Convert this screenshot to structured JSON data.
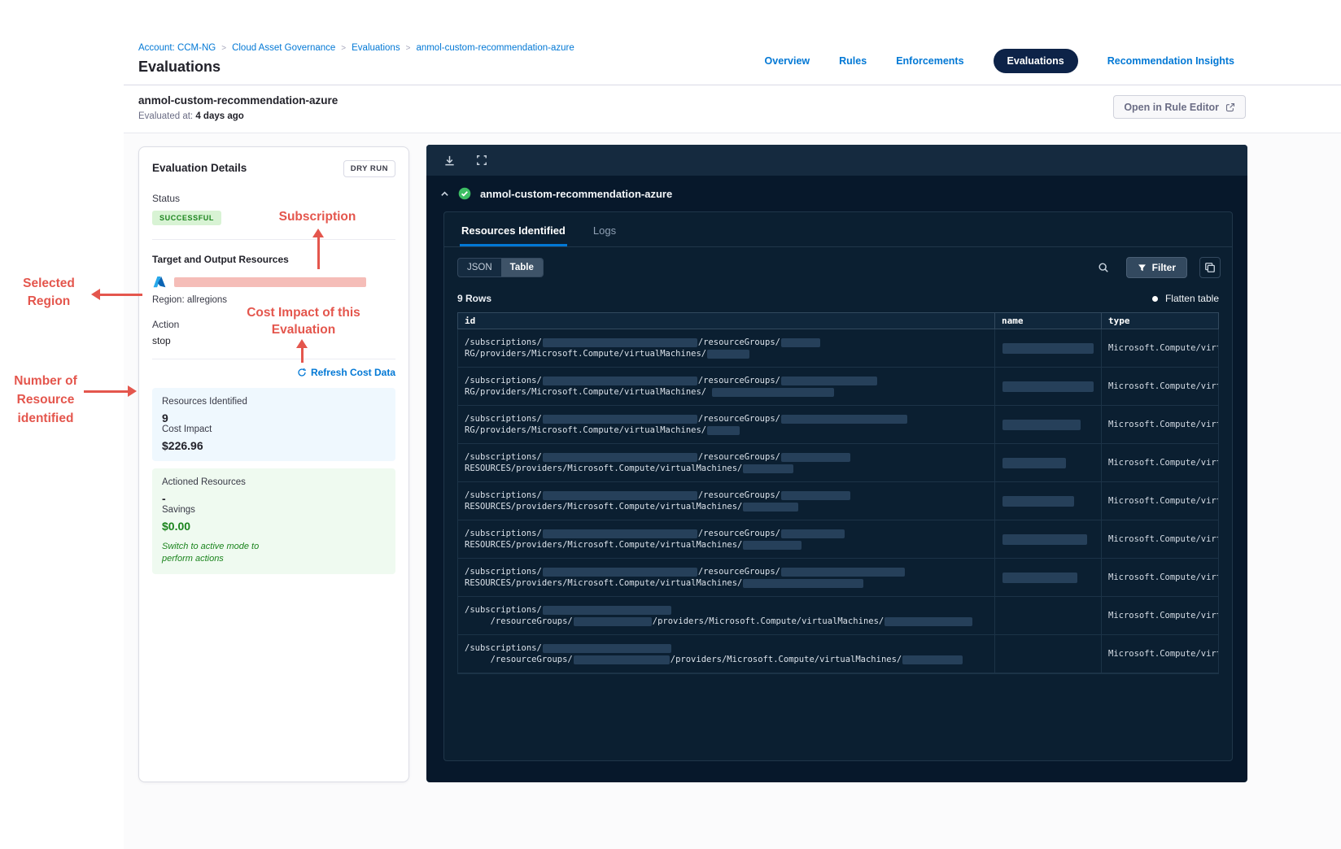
{
  "breadcrumb": {
    "items": [
      "Account: CCM-NG",
      "Cloud Asset Governance",
      "Evaluations",
      "anmol-custom-recommendation-azure"
    ],
    "separator": ">"
  },
  "page": {
    "title": "Evaluations"
  },
  "nav": {
    "tabs": [
      {
        "label": "Overview"
      },
      {
        "label": "Rules"
      },
      {
        "label": "Enforcements"
      },
      {
        "label": "Evaluations"
      },
      {
        "label": "Recommendation Insights"
      }
    ]
  },
  "subheader": {
    "rule_name": "anmol-custom-recommendation-azure",
    "evaluated_label": "Evaluated at:",
    "evaluated_value": "4 days ago",
    "open_rule_editor": "Open in Rule Editor"
  },
  "details": {
    "title": "Evaluation Details",
    "dry_run": "DRY RUN",
    "status_label": "Status",
    "status_value": "SUCCESSFUL",
    "target_label": "Target and Output Resources",
    "region": "Region: allregions",
    "action_label": "Action",
    "action_value": "stop",
    "refresh_link": "Refresh Cost Data",
    "resources_identified_label": "Resources Identified",
    "resources_identified_value": "9",
    "cost_impact_label": "Cost Impact",
    "cost_impact_value": "$226.96",
    "actioned_label": "Actioned Resources",
    "actioned_value": "-",
    "savings_label": "Savings",
    "savings_value": "$0.00",
    "active_mode_note": "Switch to active mode to perform actions"
  },
  "results_panel": {
    "title": "anmol-custom-recommendation-azure",
    "tabs": [
      {
        "label": "Resources Identified"
      },
      {
        "label": "Logs"
      }
    ],
    "view_toggle": [
      {
        "label": "JSON"
      },
      {
        "label": "Table"
      }
    ],
    "filter_label": "Filter",
    "rows_count": "9 Rows",
    "flatten_label": "Flatten table",
    "table": {
      "columns": [
        "id",
        "name",
        "type"
      ],
      "rows": [
        {
          "l1": [
            [
              "t",
              "/subscriptions/"
            ],
            [
              "r",
              190
            ],
            [
              "t",
              "/resourceGroups/"
            ],
            [
              "r",
              48
            ]
          ],
          "l2": [
            [
              "t",
              "RG/providers/Microsoft.Compute/virtualMachines/"
            ],
            [
              "r",
              52
            ]
          ],
          "name_w": 112,
          "type": "Microsoft.Compute/virtu"
        },
        {
          "l1": [
            [
              "t",
              "/subscriptions/"
            ],
            [
              "r",
              190
            ],
            [
              "t",
              "/resourceGroups/"
            ],
            [
              "r",
              118
            ]
          ],
          "l2": [
            [
              "t",
              "RG/providers/Microsoft.Compute/virtualMachines/ "
            ],
            [
              "r",
              150
            ]
          ],
          "name_w": 112,
          "type": "Microsoft.Compute/virtu"
        },
        {
          "l1": [
            [
              "t",
              "/subscriptions/"
            ],
            [
              "r",
              190
            ],
            [
              "t",
              "/resourceGroups/"
            ],
            [
              "r",
              155
            ]
          ],
          "l2": [
            [
              "t",
              "RG/providers/Microsoft.Compute/virtualMachines/"
            ],
            [
              "r",
              40
            ]
          ],
          "name_w": 96,
          "type": "Microsoft.Compute/virtu"
        },
        {
          "l1": [
            [
              "t",
              "/subscriptions/"
            ],
            [
              "r",
              190
            ],
            [
              "t",
              "/resourceGroups/"
            ],
            [
              "r",
              85
            ]
          ],
          "l2": [
            [
              "t",
              "RESOURCES/providers/Microsoft.Compute/virtualMachines/"
            ],
            [
              "r",
              62
            ]
          ],
          "name_w": 78,
          "type": "Microsoft.Compute/virtu"
        },
        {
          "l1": [
            [
              "t",
              "/subscriptions/"
            ],
            [
              "r",
              190
            ],
            [
              "t",
              "/resourceGroups/"
            ],
            [
              "r",
              85
            ]
          ],
          "l2": [
            [
              "t",
              "RESOURCES/providers/Microsoft.Compute/virtualMachines/"
            ],
            [
              "r",
              68
            ]
          ],
          "name_w": 88,
          "type": "Microsoft.Compute/virtu"
        },
        {
          "l1": [
            [
              "t",
              "/subscriptions/"
            ],
            [
              "r",
              190
            ],
            [
              "t",
              "/resourceGroups/"
            ],
            [
              "r",
              78
            ]
          ],
          "l2": [
            [
              "t",
              "RESOURCES/providers/Microsoft.Compute/virtualMachines/"
            ],
            [
              "r",
              72
            ]
          ],
          "name_w": 104,
          "type": "Microsoft.Compute/virtu"
        },
        {
          "l1": [
            [
              "t",
              "/subscriptions/"
            ],
            [
              "r",
              190
            ],
            [
              "t",
              "/resourceGroups/"
            ],
            [
              "r",
              152
            ]
          ],
          "l2": [
            [
              "t",
              "RESOURCES/providers/Microsoft.Compute/virtualMachines/"
            ],
            [
              "r",
              148
            ]
          ],
          "name_w": 92,
          "type": "Microsoft.Compute/virtu"
        },
        {
          "l1": [
            [
              "t",
              "/subscriptions/"
            ],
            [
              "r",
              158
            ]
          ],
          "l2": [
            [
              "t",
              "     /resourceGroups/"
            ],
            [
              "r",
              96
            ],
            [
              "t",
              "/providers/Microsoft.Compute/virtualMachines/"
            ],
            [
              "r",
              108
            ]
          ],
          "name_w": 0,
          "type": "Microsoft.Compute/virtu"
        },
        {
          "l1": [
            [
              "t",
              "/subscriptions/"
            ],
            [
              "r",
              158
            ]
          ],
          "l2": [
            [
              "t",
              "     /resourceGroups/"
            ],
            [
              "r",
              118
            ],
            [
              "t",
              "/providers/Microsoft.Compute/virtualMachines/"
            ],
            [
              "r",
              74
            ]
          ],
          "name_w": 0,
          "type": "Microsoft.Compute/virtu"
        }
      ]
    }
  },
  "annotations": {
    "subscription": "Subscription",
    "selected_region": "Selected Region",
    "cost_impact": "Cost Impact of this Evaluation",
    "resource_count": "Number of Resource identified"
  },
  "colors": {
    "accent_blue": "#0278D5",
    "annotation_red": "#E4564D",
    "panel_navy": "#07182B",
    "status_green": "#1B841D",
    "redaction_pink": "#F5BDB8"
  }
}
